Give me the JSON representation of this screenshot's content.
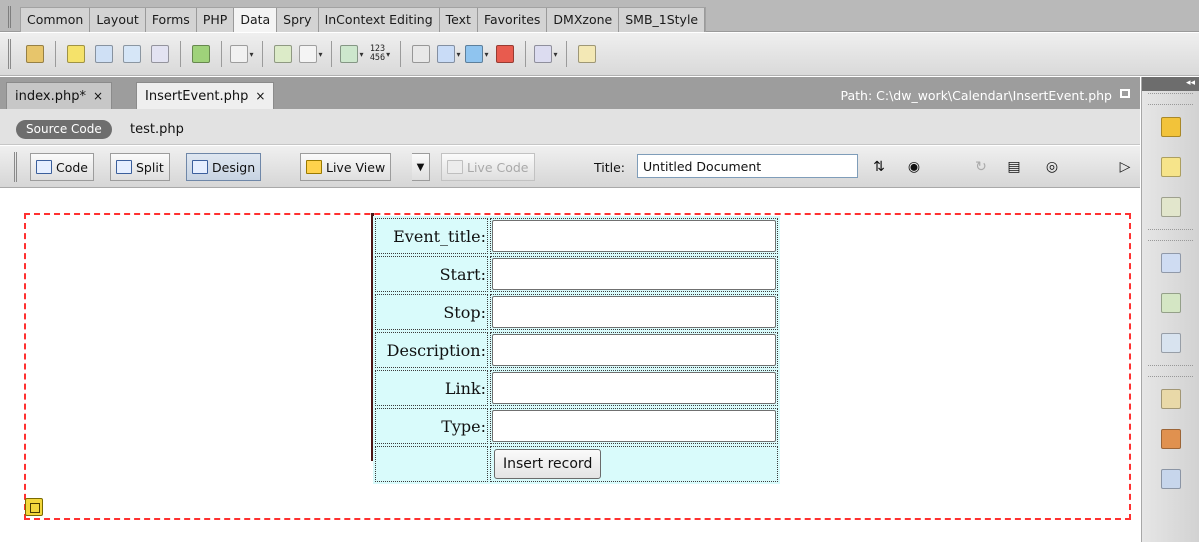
{
  "insert_bar": {
    "tabs": [
      "Common",
      "Layout",
      "Forms",
      "PHP",
      "Data",
      "Spry",
      "InContext Editing",
      "Text",
      "Favorites",
      "DMXzone",
      "SMB_1Style"
    ],
    "active_tab": "Data",
    "number_glyph": "123\n456"
  },
  "document_tabs": [
    {
      "label": "index.php*",
      "close": "×"
    },
    {
      "label": "InsertEvent.php",
      "close": "×"
    }
  ],
  "path": "Path: C:\\dw_work\\Calendar\\InsertEvent.php",
  "related_files": {
    "source_code": "Source Code",
    "file": "test.php"
  },
  "doc_toolbar": {
    "code": "Code",
    "split": "Split",
    "design": "Design",
    "live_view": "Live View",
    "live_code": "Live Code",
    "title_label": "Title:",
    "title_value": "Untitled Document"
  },
  "form": {
    "fields": [
      {
        "label": "Event_title:",
        "value": ""
      },
      {
        "label": "Start:",
        "value": ""
      },
      {
        "label": "Stop:",
        "value": ""
      },
      {
        "label": "Description:",
        "value": ""
      },
      {
        "label": "Link:",
        "value": ""
      },
      {
        "label": "Type:",
        "value": ""
      }
    ],
    "submit_label": "Insert record"
  },
  "colors": {
    "form_outline": "#ff3131",
    "table_bg": "#d9fbfb",
    "active_tab": "#f4f4f4"
  }
}
